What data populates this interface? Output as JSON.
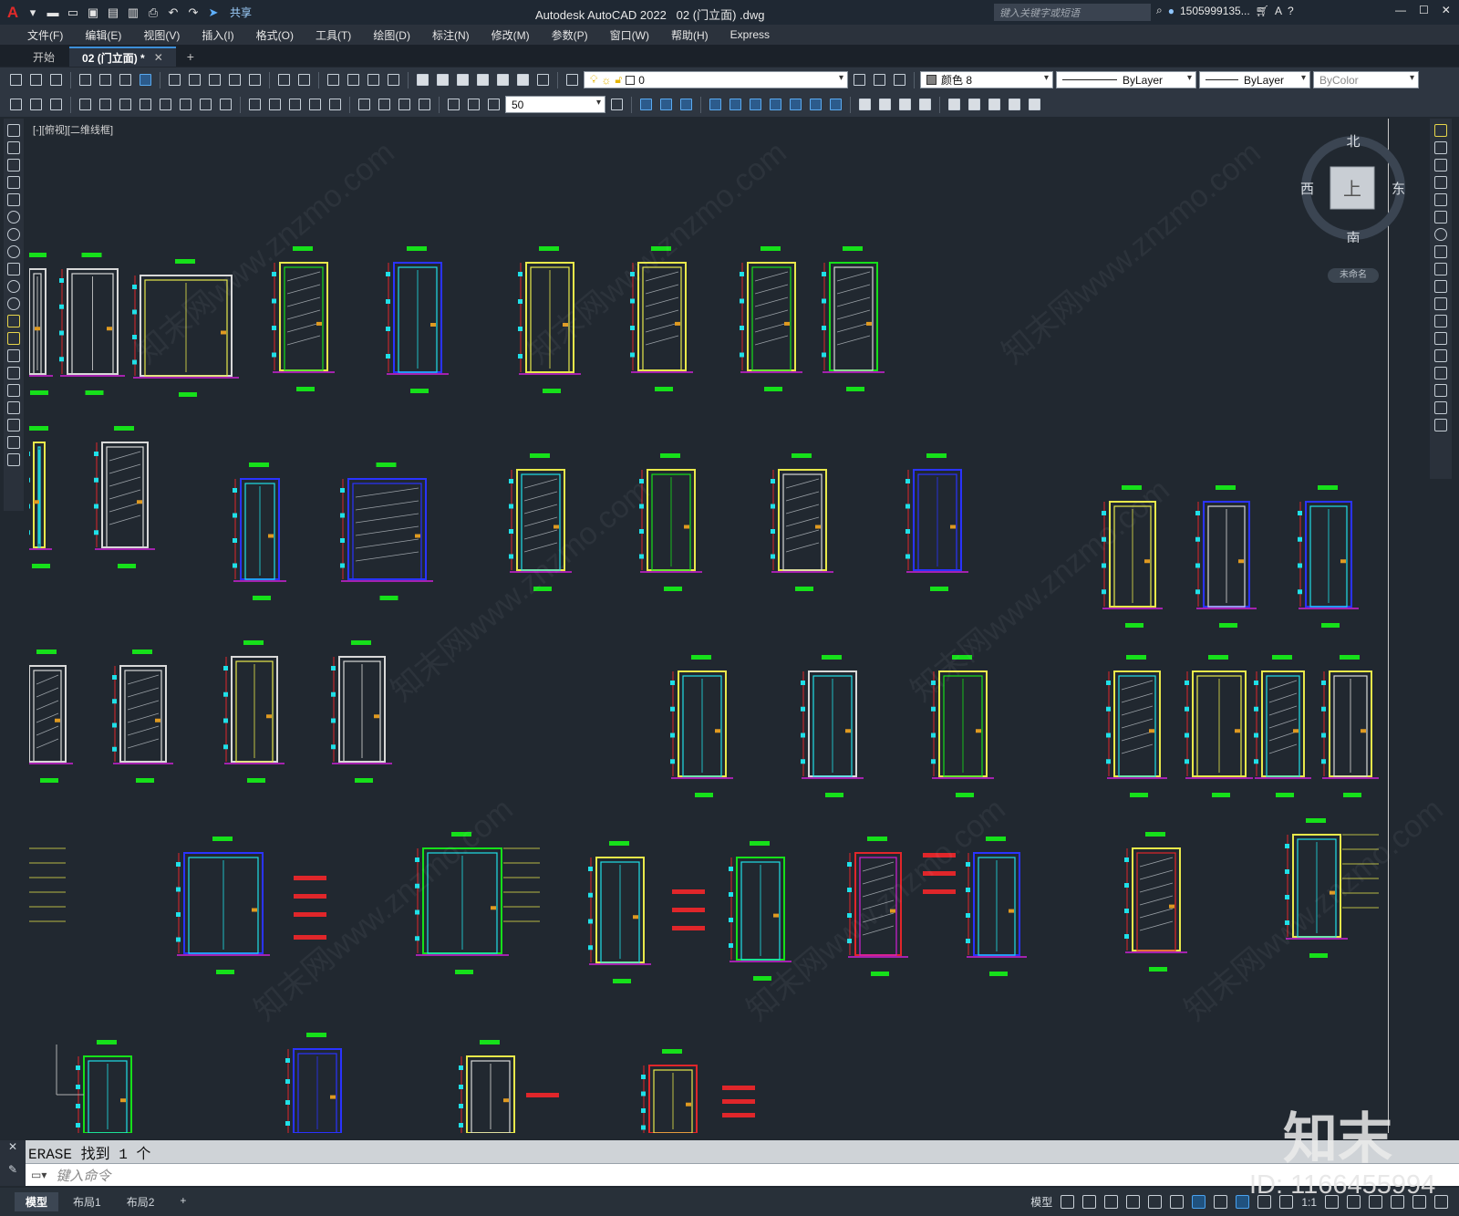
{
  "app": {
    "logo": "A",
    "title": "Autodesk AutoCAD 2022",
    "document": "02 (门立面) .dwg",
    "share_label": "共享",
    "search_placeholder": "键入关键字或短语",
    "user": "1505999135...",
    "accent_color": "#3d8fd8"
  },
  "menu": [
    "文件(F)",
    "编辑(E)",
    "视图(V)",
    "插入(I)",
    "格式(O)",
    "工具(T)",
    "绘图(D)",
    "标注(N)",
    "修改(M)",
    "参数(P)",
    "窗口(W)",
    "帮助(H)",
    "Express"
  ],
  "tabs": [
    {
      "label": "开始",
      "active": false
    },
    {
      "label": "02 (门立面) *",
      "active": true
    }
  ],
  "toolbar": {
    "layer_value": "0",
    "color_value": "颜色 8",
    "linetype_value": "ByLayer",
    "lineweight_value": "ByLayer",
    "plotstyle_value": "ByColor",
    "dim_scale_value": "50"
  },
  "viewport": {
    "label": "[-][俯视][二维线框]",
    "viewcube": {
      "north": "北",
      "south": "南",
      "east": "东",
      "west": "西",
      "face": "上"
    },
    "ucs_label": "未命名"
  },
  "command": {
    "history": "ERASE  找到 1 个",
    "placeholder": "键入命令"
  },
  "layouts": [
    {
      "label": "模型",
      "active": true
    },
    {
      "label": "布局1",
      "active": false
    },
    {
      "label": "布局2",
      "active": false
    }
  ],
  "status": {
    "model_label": "模型",
    "scale": "1:1"
  },
  "watermark": {
    "logo": "知末",
    "id": "ID: 1166455994",
    "diagonal": "知末网www.znzmo.com"
  },
  "colors": {
    "cad_yellow": "#e8e84a",
    "cad_red": "#e0262a",
    "cad_green": "#16e01a",
    "cad_cyan": "#1fe0e8",
    "cad_blue": "#2a33ff",
    "cad_magenta": "#d020d8",
    "cad_white": "#d8d8d8"
  }
}
